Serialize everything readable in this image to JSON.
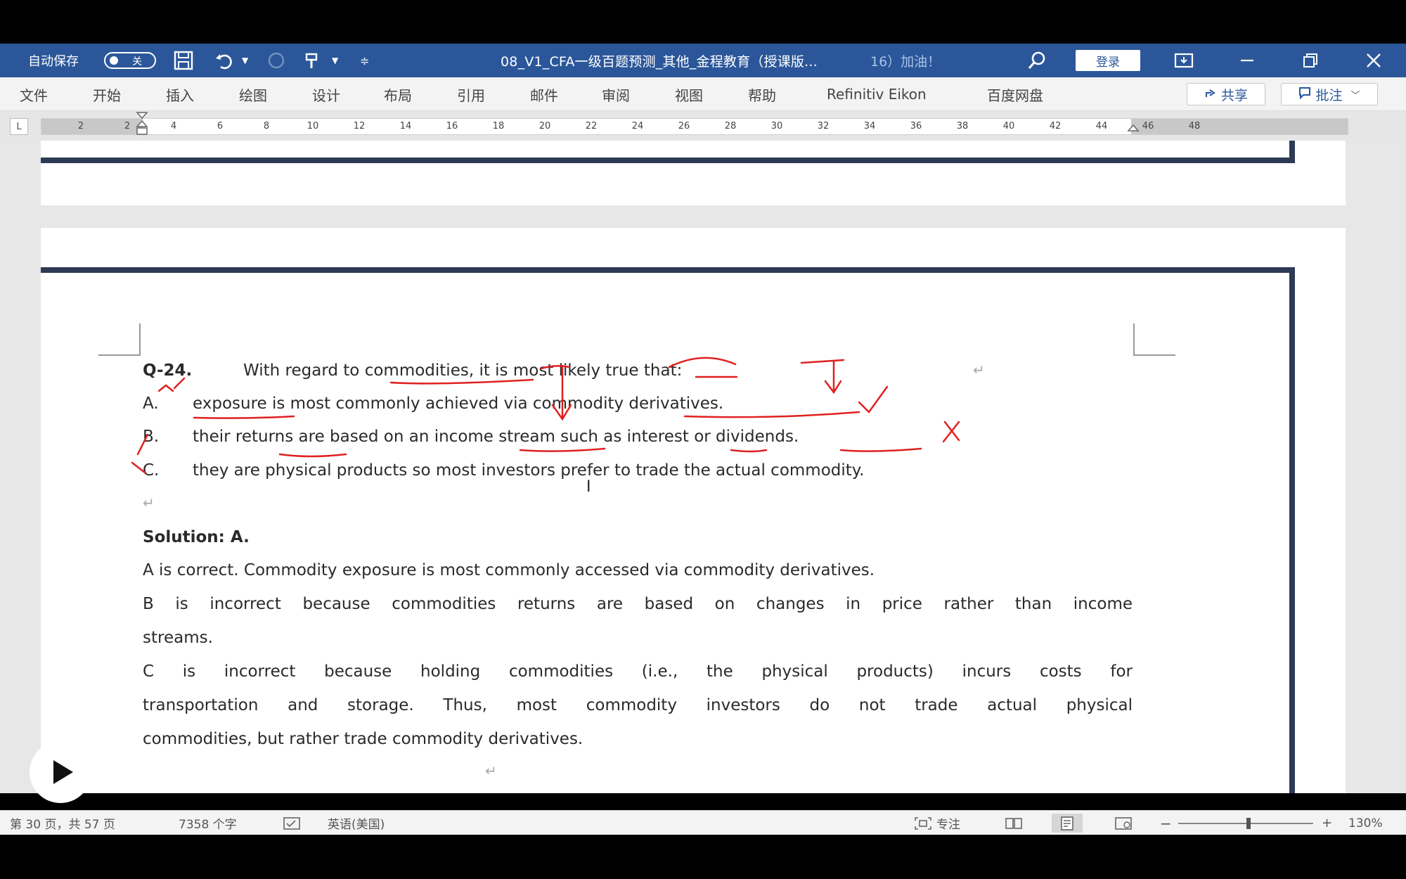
{
  "titlebar": {
    "autosave_label": "自动保存",
    "autosave_state": "关",
    "doc_title": "08_V1_CFA一级百题预测_其他_金程教育（授课版...",
    "doc_title_suffix": "16）加油！",
    "login_label": "登录"
  },
  "menubar": {
    "items": [
      "文件",
      "开始",
      "插入",
      "绘图",
      "设计",
      "布局",
      "引用",
      "邮件",
      "审阅",
      "视图",
      "帮助",
      "Refinitiv Eikon",
      "百度网盘"
    ],
    "share_label": "共享",
    "comment_label": "批注"
  },
  "ruler": {
    "tab_stop": "L",
    "numbers": [
      "2",
      "2",
      "4",
      "6",
      "8",
      "10",
      "12",
      "14",
      "16",
      "18",
      "20",
      "22",
      "24",
      "26",
      "28",
      "30",
      "32",
      "34",
      "36",
      "38",
      "40",
      "42",
      "44",
      "46",
      "48"
    ]
  },
  "document": {
    "question_label": "Q-24.",
    "question_text": "With regard to commodities, it is most likely true that:",
    "options": [
      {
        "label": "A.",
        "text": "exposure is most commonly achieved via commodity derivatives."
      },
      {
        "label": "B.",
        "text": "their returns are based on an income stream such as interest or dividends."
      },
      {
        "label": "C.",
        "text": "they are physical products so most investors prefer to trade the actual commodity."
      }
    ],
    "solution_label": "Solution: A.",
    "explanation_a": "A is correct. Commodity exposure is most commonly accessed via commodity derivatives.",
    "explanation_b_1": "B is incorrect because commodities returns are based on changes in price rather than income",
    "explanation_b_2": "streams.",
    "explanation_c_1": "C is incorrect because holding commodities (i.e., the physical products) incurs costs for",
    "explanation_c_2": "transportation and storage. Thus, most commodity investors do not trade actual physical",
    "explanation_c_3": "commodities, but rather trade commodity derivatives.",
    "paragraph_mark": "↵"
  },
  "statusbar": {
    "page_info": "第 30 页，共 57 页",
    "word_count": "7358 个字",
    "language": "英语(美国)",
    "focus_label": "专注",
    "zoom_level": "130%",
    "zoom_fraction": 0.52
  },
  "colors": {
    "titlebar": "#2b579a",
    "page_border": "#2d3a55",
    "annotation": "#e02020"
  }
}
